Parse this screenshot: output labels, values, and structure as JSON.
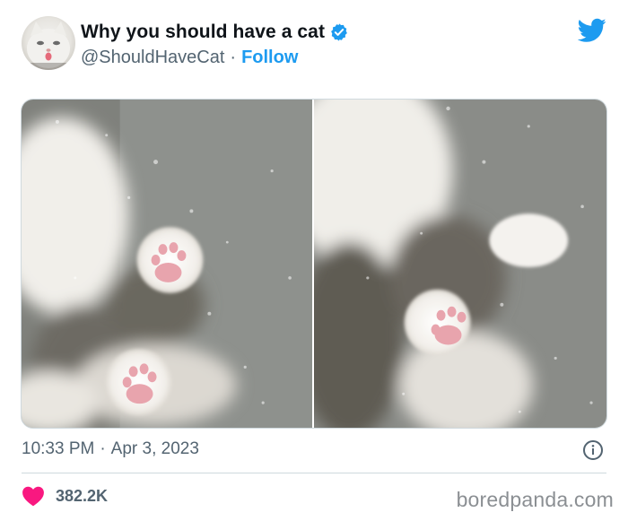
{
  "header": {
    "display_name": "Why you should have a cat",
    "handle": "@ShouldHaveCat",
    "separator": "·",
    "follow_label": "Follow",
    "verified_icon": "verified-badge-icon",
    "platform_icon": "twitter-bird-icon"
  },
  "media": {
    "photos": [
      "cat-paws-on-glass-left",
      "cat-paws-on-glass-right"
    ]
  },
  "footer": {
    "time": "10:33 PM",
    "separator": "·",
    "date": "Apr 3, 2023",
    "likes": "382.2K",
    "info_icon": "info-icon",
    "heart_icon": "heart-icon"
  },
  "watermark": "boredpanda.com",
  "colors": {
    "accent": "#1d9bf0",
    "heart": "#f91880",
    "text_primary": "#0f1419",
    "text_secondary": "#536471",
    "border": "#cfd9de"
  }
}
